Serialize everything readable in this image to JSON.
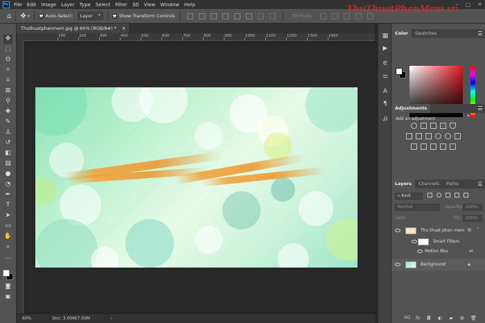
{
  "app": {
    "logo": "Ps"
  },
  "menu": [
    "File",
    "Edit",
    "Image",
    "Layer",
    "Type",
    "Select",
    "Filter",
    "3D",
    "View",
    "Window",
    "Help"
  ],
  "window_controls": [
    "–",
    "□",
    "✕"
  ],
  "watermark": "ThuThuatPhanMem.vn",
  "options_bar": {
    "auto_select_label": "Auto-Select:",
    "auto_select_target": "Layer",
    "show_transform_label": "Show Transform Controls",
    "mode_3d_label": "3D Mode:"
  },
  "document": {
    "tab_title": "Thuthuatphanmem.jpg @ 60% (RGB/8#) *",
    "tab_close": "✕",
    "zoom": "60%",
    "doc_size": "Doc: 3.00M/7.00M",
    "status_arrow": "›"
  },
  "ruler_ticks": [
    "100",
    "200",
    "300",
    "400",
    "500",
    "600",
    "700",
    "800",
    "900",
    "1000",
    "1100",
    "1200",
    "1300",
    "1400"
  ],
  "color_panel": {
    "tabs": [
      "Color",
      "Swatches"
    ],
    "foreground_color": "#ffffff",
    "background_color": "#000000",
    "selected_hue": "#e0151f"
  },
  "adjustments_panel": {
    "title": "Adjustments",
    "subtitle": "Add an adjustment"
  },
  "layers_panel": {
    "tabs": [
      "Layers",
      "Channels",
      "Paths"
    ],
    "kind_label": "Kind",
    "blend_mode": "Normal",
    "opacity_label": "Opacity:",
    "opacity_value": "100%",
    "lock_label": "Lock:",
    "fill_label": "Fill:",
    "fill_value": "100%",
    "layers": [
      {
        "name": "Thu thuat phan mem",
        "type": "smart-object"
      },
      {
        "name": "Smart Filters",
        "type": "smart-filters"
      },
      {
        "name": "Motion Blur",
        "type": "filter"
      },
      {
        "name": "Background",
        "type": "background"
      }
    ],
    "bottom_icons": [
      "GO",
      "fx"
    ]
  },
  "colors": {
    "accent": "#31a8ff",
    "panel_bg": "#535353",
    "app_bg": "#282828"
  }
}
